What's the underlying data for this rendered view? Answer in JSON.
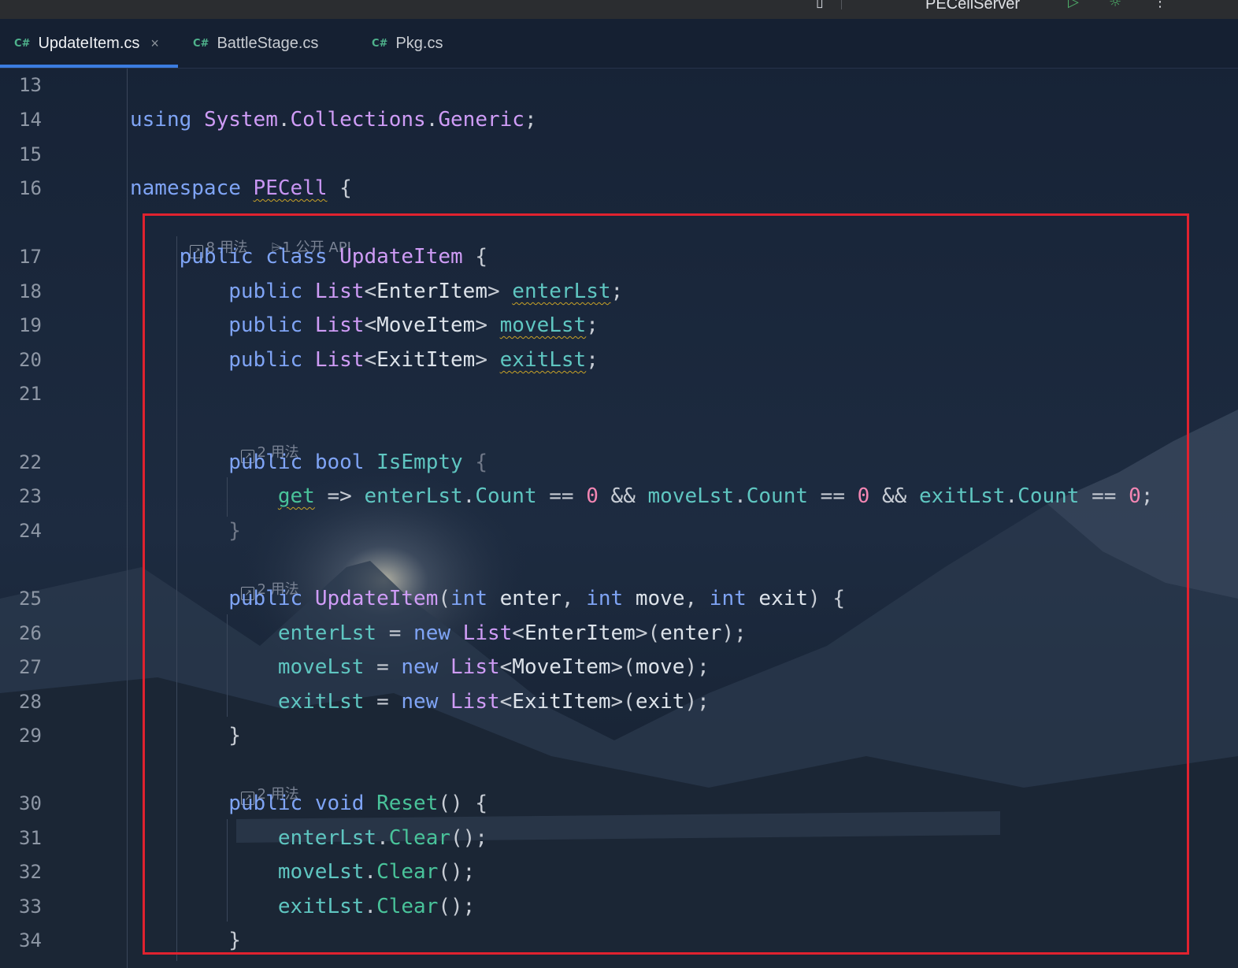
{
  "toolbar": {
    "run_config": "PECellServer"
  },
  "tabs": [
    {
      "icon": "C#",
      "label": "UpdateItem.cs",
      "close": "×"
    },
    {
      "icon": "C#",
      "label": "BattleStage.cs"
    },
    {
      "icon": "C#",
      "label": "Pkg.cs"
    }
  ],
  "hints": {
    "class_usages": "8 用法",
    "class_api": "1 公开 API",
    "isempty_usages": "2 用法",
    "ctor_usages": "2 用法",
    "reset_usages": "2 用法"
  },
  "lines": [
    {
      "n": "13",
      "tokens": []
    },
    {
      "n": "14",
      "tokens": [
        [
          "kw",
          "using"
        ],
        [
          "punc",
          " "
        ],
        [
          "type",
          "System"
        ],
        [
          "punc",
          "."
        ],
        [
          "type",
          "Collections"
        ],
        [
          "punc",
          "."
        ],
        [
          "type",
          "Generic"
        ],
        [
          "punc",
          ";"
        ]
      ]
    },
    {
      "n": "15",
      "tokens": []
    },
    {
      "n": "16",
      "tokens": [
        [
          "kw",
          "namespace"
        ],
        [
          "punc",
          " "
        ],
        [
          "ns wavy",
          "PECell"
        ],
        [
          "punc",
          " {"
        ]
      ]
    },
    {
      "n": "17",
      "tokens": [
        [
          "punc",
          "    "
        ],
        [
          "kw",
          "public"
        ],
        [
          "punc",
          " "
        ],
        [
          "kw",
          "class"
        ],
        [
          "punc",
          " "
        ],
        [
          "type",
          "UpdateItem"
        ],
        [
          "punc",
          " {"
        ]
      ]
    },
    {
      "n": "18",
      "tokens": [
        [
          "punc",
          "        "
        ],
        [
          "kw",
          "public"
        ],
        [
          "punc",
          " "
        ],
        [
          "type",
          "List"
        ],
        [
          "punc",
          "<"
        ],
        [
          "ident",
          "EnterItem"
        ],
        [
          "punc",
          "> "
        ],
        [
          "field wavy",
          "enterLst"
        ],
        [
          "punc",
          ";"
        ]
      ]
    },
    {
      "n": "19",
      "tokens": [
        [
          "punc",
          "        "
        ],
        [
          "kw",
          "public"
        ],
        [
          "punc",
          " "
        ],
        [
          "type",
          "List"
        ],
        [
          "punc",
          "<"
        ],
        [
          "ident",
          "MoveItem"
        ],
        [
          "punc",
          "> "
        ],
        [
          "field wavy",
          "moveLst"
        ],
        [
          "punc",
          ";"
        ]
      ]
    },
    {
      "n": "20",
      "tokens": [
        [
          "punc",
          "        "
        ],
        [
          "kw",
          "public"
        ],
        [
          "punc",
          " "
        ],
        [
          "type",
          "List"
        ],
        [
          "punc",
          "<"
        ],
        [
          "ident",
          "ExitItem"
        ],
        [
          "punc",
          "> "
        ],
        [
          "field wavy",
          "exitLst"
        ],
        [
          "punc",
          ";"
        ]
      ]
    },
    {
      "n": "21",
      "tokens": []
    },
    {
      "n": "22",
      "tokens": [
        [
          "punc",
          "        "
        ],
        [
          "kw",
          "public"
        ],
        [
          "punc",
          " "
        ],
        [
          "kw",
          "bool"
        ],
        [
          "punc",
          " "
        ],
        [
          "field",
          "IsEmpty"
        ],
        [
          "punc",
          " "
        ],
        [
          "dim",
          "{"
        ]
      ]
    },
    {
      "n": "23",
      "tokens": [
        [
          "punc",
          "            "
        ],
        [
          "method wavy",
          "get"
        ],
        [
          "punc",
          " => "
        ],
        [
          "field",
          "enterLst"
        ],
        [
          "punc",
          "."
        ],
        [
          "field",
          "Count"
        ],
        [
          "punc",
          " == "
        ],
        [
          "num",
          "0"
        ],
        [
          "punc",
          " && "
        ],
        [
          "field",
          "moveLst"
        ],
        [
          "punc",
          "."
        ],
        [
          "field",
          "Count"
        ],
        [
          "punc",
          " == "
        ],
        [
          "num",
          "0"
        ],
        [
          "punc",
          " && "
        ],
        [
          "field",
          "exitLst"
        ],
        [
          "punc",
          "."
        ],
        [
          "field",
          "Count"
        ],
        [
          "punc",
          " == "
        ],
        [
          "num",
          "0"
        ],
        [
          "punc",
          ";"
        ]
      ]
    },
    {
      "n": "24",
      "tokens": [
        [
          "punc",
          "        "
        ],
        [
          "dim",
          "}"
        ]
      ]
    },
    {
      "n": "25",
      "tokens": [
        [
          "punc",
          "        "
        ],
        [
          "kw",
          "public"
        ],
        [
          "punc",
          " "
        ],
        [
          "type",
          "UpdateItem"
        ],
        [
          "punc",
          "("
        ],
        [
          "kw",
          "int"
        ],
        [
          "punc",
          " "
        ],
        [
          "ident",
          "enter"
        ],
        [
          "punc",
          ", "
        ],
        [
          "kw",
          "int"
        ],
        [
          "punc",
          " "
        ],
        [
          "ident",
          "move"
        ],
        [
          "punc",
          ", "
        ],
        [
          "kw",
          "int"
        ],
        [
          "punc",
          " "
        ],
        [
          "ident",
          "exit"
        ],
        [
          "punc",
          ") {"
        ]
      ]
    },
    {
      "n": "26",
      "tokens": [
        [
          "punc",
          "            "
        ],
        [
          "field",
          "enterLst"
        ],
        [
          "punc",
          " = "
        ],
        [
          "kw",
          "new"
        ],
        [
          "punc",
          " "
        ],
        [
          "type",
          "List"
        ],
        [
          "punc",
          "<"
        ],
        [
          "ident",
          "EnterItem"
        ],
        [
          "punc",
          ">("
        ],
        [
          "ident",
          "enter"
        ],
        [
          "punc",
          ");"
        ]
      ]
    },
    {
      "n": "27",
      "tokens": [
        [
          "punc",
          "            "
        ],
        [
          "field",
          "moveLst"
        ],
        [
          "punc",
          " = "
        ],
        [
          "kw",
          "new"
        ],
        [
          "punc",
          " "
        ],
        [
          "type",
          "List"
        ],
        [
          "punc",
          "<"
        ],
        [
          "ident",
          "MoveItem"
        ],
        [
          "punc",
          ">("
        ],
        [
          "ident",
          "move"
        ],
        [
          "punc",
          ");"
        ]
      ]
    },
    {
      "n": "28",
      "tokens": [
        [
          "punc",
          "            "
        ],
        [
          "field",
          "exitLst"
        ],
        [
          "punc",
          " = "
        ],
        [
          "kw",
          "new"
        ],
        [
          "punc",
          " "
        ],
        [
          "type",
          "List"
        ],
        [
          "punc",
          "<"
        ],
        [
          "ident",
          "ExitItem"
        ],
        [
          "punc",
          ">("
        ],
        [
          "ident",
          "exit"
        ],
        [
          "punc",
          ");"
        ]
      ]
    },
    {
      "n": "29",
      "tokens": [
        [
          "punc",
          "        }"
        ]
      ]
    },
    {
      "n": "30",
      "tokens": [
        [
          "punc",
          "        "
        ],
        [
          "kw",
          "public"
        ],
        [
          "punc",
          " "
        ],
        [
          "kw",
          "void"
        ],
        [
          "punc",
          " "
        ],
        [
          "method",
          "Reset"
        ],
        [
          "punc",
          "() {"
        ]
      ]
    },
    {
      "n": "31",
      "tokens": [
        [
          "punc",
          "            "
        ],
        [
          "field",
          "enterLst"
        ],
        [
          "punc",
          "."
        ],
        [
          "method",
          "Clear"
        ],
        [
          "punc",
          "();"
        ]
      ]
    },
    {
      "n": "32",
      "tokens": [
        [
          "punc",
          "            "
        ],
        [
          "field",
          "moveLst"
        ],
        [
          "punc",
          "."
        ],
        [
          "method",
          "Clear"
        ],
        [
          "punc",
          "();"
        ]
      ]
    },
    {
      "n": "33",
      "tokens": [
        [
          "punc",
          "            "
        ],
        [
          "field",
          "exitLst"
        ],
        [
          "punc",
          "."
        ],
        [
          "method",
          "Clear"
        ],
        [
          "punc",
          "();"
        ]
      ]
    },
    {
      "n": "34",
      "tokens": [
        [
          "punc",
          "        }"
        ]
      ]
    }
  ],
  "colors": {
    "accent": "#3b7ce0",
    "selection_border": "#e0222f"
  }
}
